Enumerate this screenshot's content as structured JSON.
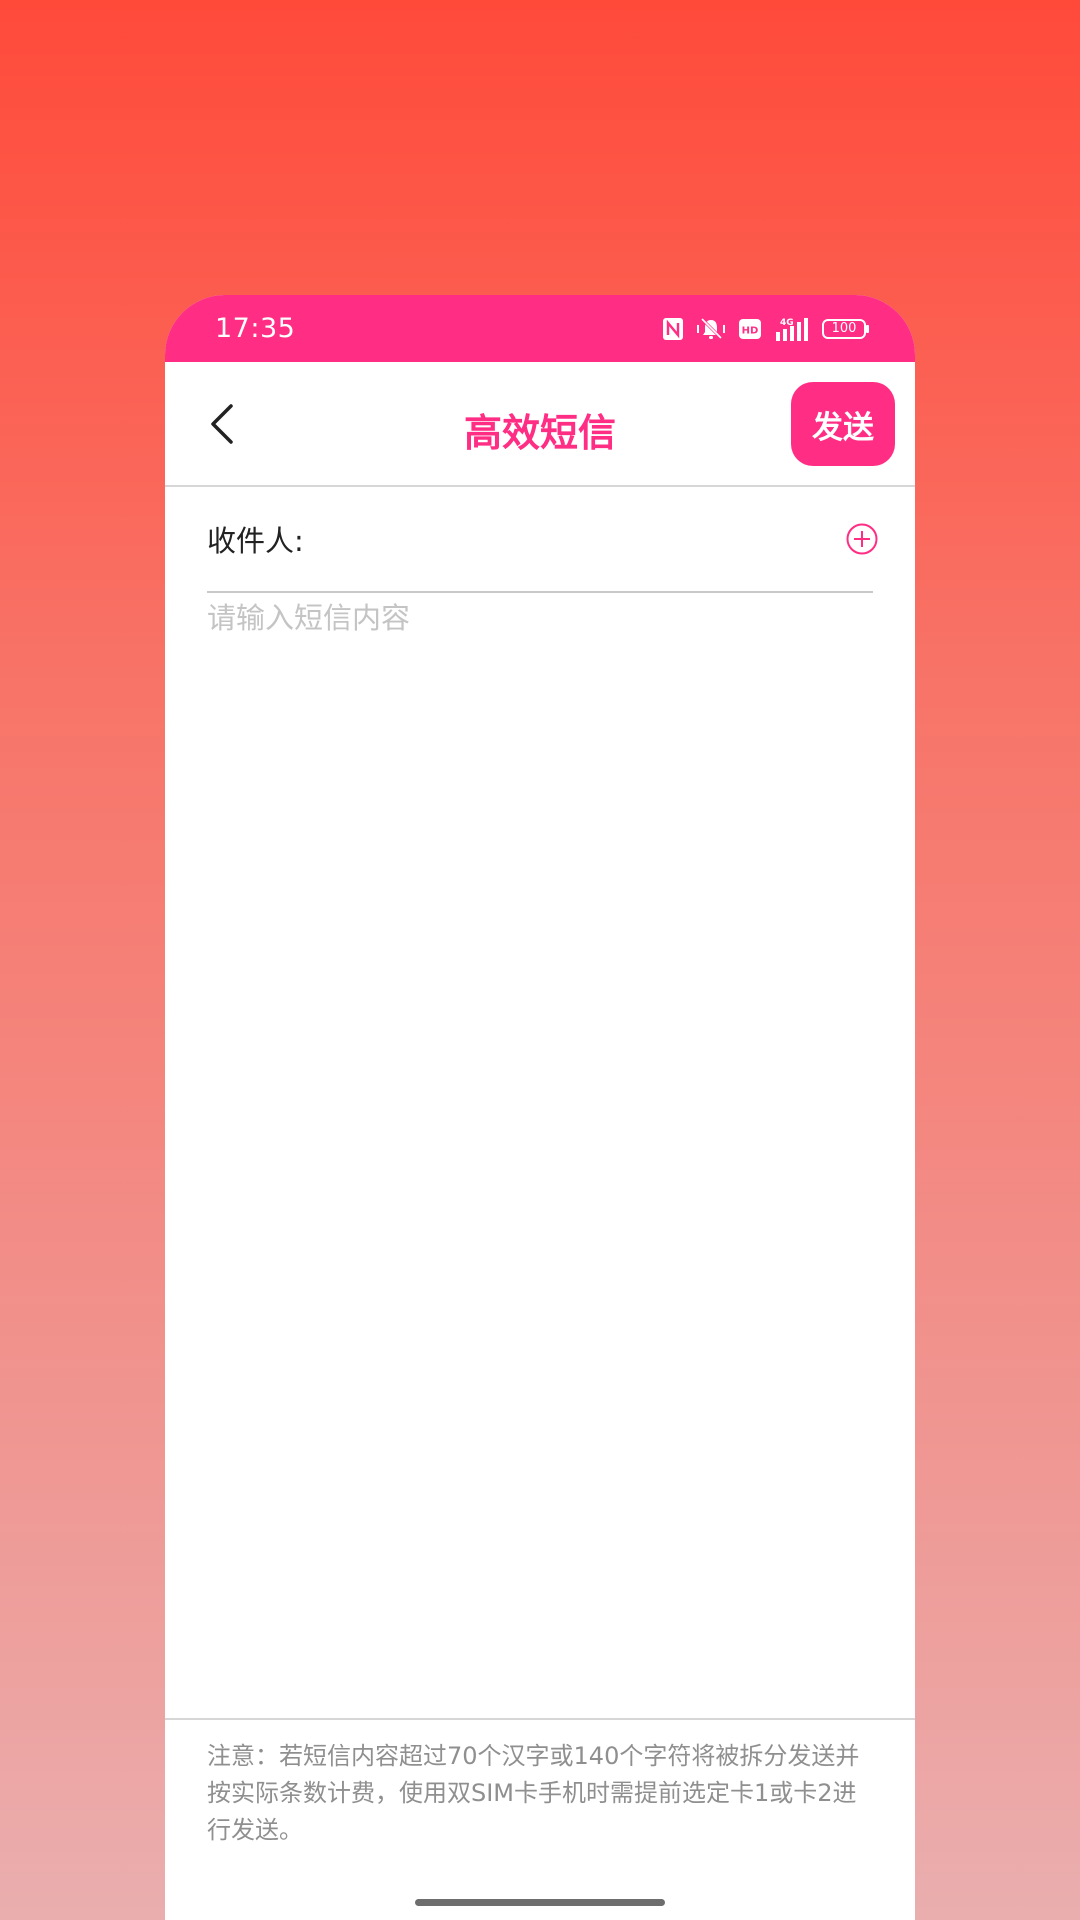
{
  "status_bar": {
    "time": "17:35",
    "battery": "100",
    "network": "4G",
    "icons": [
      "nfc-icon",
      "mute-vibrate-icon",
      "hd-icon",
      "signal-icon",
      "battery-icon"
    ]
  },
  "header": {
    "title": "高效短信",
    "send_label": "发送"
  },
  "recipient": {
    "label": "收件人:",
    "value": "",
    "add_icon": "plus-circle-icon"
  },
  "content": {
    "placeholder": "请输入短信内容",
    "value": ""
  },
  "notice": {
    "text": "注意：若短信内容超过70个汉字或140个字符将被拆分发送并按实际条数计费，使用双SIM卡手机时需提前选定卡1或卡2进行发送。"
  },
  "colors": {
    "accent": "#ff2d84",
    "background_top": "#ff4a3a",
    "background_bottom": "#eaaeae"
  }
}
